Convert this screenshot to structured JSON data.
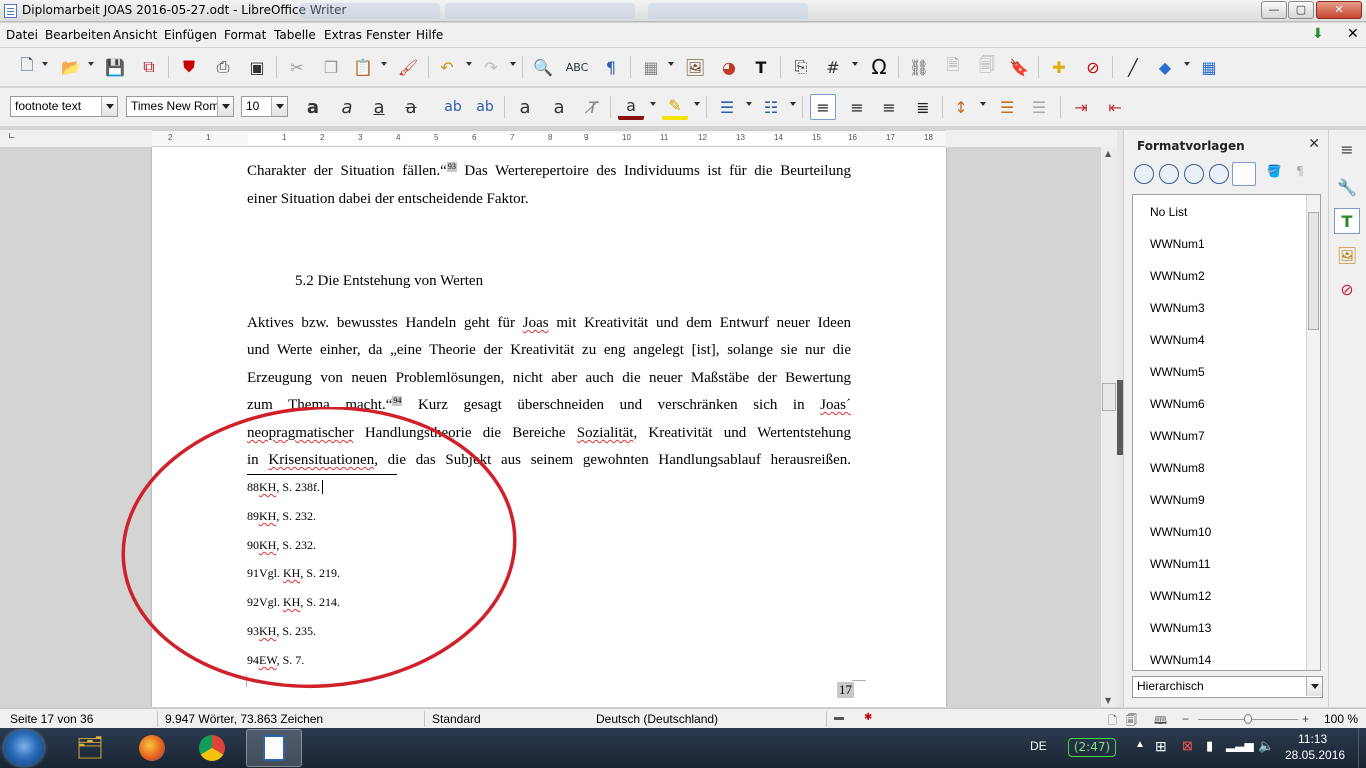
{
  "window": {
    "title": "Diplomarbeit JOAS 2016-05-27.odt - LibreOffice Writer",
    "controls": {
      "minimize": "—",
      "maximize": "▢",
      "close": "✕"
    }
  },
  "menu": [
    "Datei",
    "Bearbeiten",
    "Ansicht",
    "Einfügen",
    "Format",
    "Tabelle",
    "Extras",
    "Fenster",
    "Hilfe"
  ],
  "formatting": {
    "paragraph_style": "footnote text",
    "font_name": "Times New Roman",
    "font_size": "10"
  },
  "ruler": {
    "ticks": [
      "2",
      "1",
      "1",
      "2",
      "3",
      "4",
      "5",
      "6",
      "7",
      "8",
      "9",
      "10",
      "11",
      "12",
      "13",
      "14",
      "15",
      "16",
      "17",
      "18"
    ]
  },
  "document": {
    "para1": {
      "line1_a": "Charakter der Situation fällen.“",
      "line1_ref": "93",
      "line1_b": " Das Werterepertoire des Individuums ist für die Beurteilung",
      "line2": "einer Situation dabei der entscheidende Faktor."
    },
    "heading": "5.2 Die Entstehung von Werten",
    "para2": {
      "l1_a": "Aktives bzw. bewusstes Handeln geht für ",
      "l1_joas": "Joas",
      "l1_b": " mit Kreativität und dem Entwurf neuer Ideen",
      "l2": "und Werte einher, da „eine Theorie der Kreativität zu eng angelegt [ist], solange sie nur die",
      "l3": "Erzeugung von neuen Problemlösungen, nicht aber auch die neuer Maßstäbe der Bewertung",
      "l4_a": "zum Thema macht.“",
      "l4_ref": "94",
      "l4_b": " Kurz gesagt überschneiden und verschränken sich in ",
      "l4_joas": "Joas´",
      "l5_neo": "neopragmatischer",
      "l5_b": " Handlungstheorie die Bereiche ",
      "l5_soz": "Sozialität",
      "l5_c": ", Kreativität und Wertentstehung",
      "l6_a": "in ",
      "l6_kris": "Krisensituationen",
      "l6_b": ", die das Subjekt aus seinem gewohnten Handlungsablauf herausreißen."
    },
    "footnotes": [
      {
        "num": "88",
        "src": "KH",
        "rest": ", S. 238f."
      },
      {
        "num": "89",
        "src": "KH",
        "rest": ", S. 232."
      },
      {
        "num": "90",
        "src": "KH",
        "rest": ", S. 232."
      },
      {
        "num": "91",
        "pre": "Vgl. ",
        "src": "KH",
        "rest": ", S. 219."
      },
      {
        "num": "92",
        "pre": "Vgl. ",
        "src": "KH",
        "rest": ", S. 214."
      },
      {
        "num": "93",
        "src": "KH",
        "rest": ", S. 235."
      },
      {
        "num": "94",
        "src": "EW",
        "rest": ", S. 7."
      }
    ],
    "page_number": "17"
  },
  "sidebar": {
    "title": "Formatvorlagen",
    "styles": [
      "No List",
      "WWNum1",
      "WWNum2",
      "WWNum3",
      "WWNum4",
      "WWNum5",
      "WWNum6",
      "WWNum7",
      "WWNum8",
      "WWNum9",
      "WWNum10",
      "WWNum11",
      "WWNum12",
      "WWNum13",
      "WWNum14"
    ],
    "filter": "Hierarchisch"
  },
  "status": {
    "page": "Seite 17 von 36",
    "words": "9.947 Wörter, 73.863 Zeichen",
    "page_style": "Standard",
    "language": "Deutsch (Deutschland)",
    "zoom": "100 %"
  },
  "taskbar": {
    "lang": "DE",
    "battery": "(2:47)",
    "time": "11:13",
    "date": "28.05.2016"
  },
  "colors": {
    "accent": "#2a4a7a",
    "annotation_circle": "#d0202a",
    "spellcheck": "#dd3333"
  }
}
